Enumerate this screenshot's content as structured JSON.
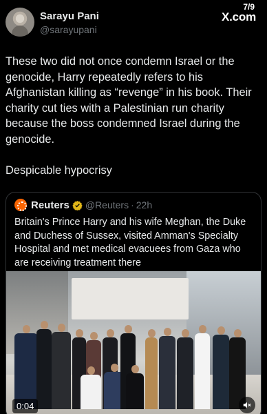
{
  "status": {
    "counter": "7/9",
    "brand": "X.com"
  },
  "author": {
    "name": "Sarayu Pani",
    "handle": "@sarayupani"
  },
  "tweet": {
    "paragraph1": "These two did not once condemn Israel or the genocide, Harry repeatedly refers to his Afghanistan killing as “revenge” in his book. Their charity cut ties with a Palestinian run charity because the boss condemned Israel during the genocide.",
    "paragraph2": "Despicable hypocrisy"
  },
  "quoted": {
    "name": "Reuters",
    "handle": "@Reuters",
    "separator": "·",
    "time": "22h",
    "text": "Britain's Prince Harry and his wife Meghan, the Duke and Duchess of Sussex, visited Amman's Specialty Hospital and met medical evacuees from Gaza who are receiving treatment there",
    "video": {
      "duration": "0:04"
    }
  },
  "icons": {
    "verified": "verified-badge-icon",
    "logo": "reuters-logo-icon",
    "mute": "speaker-muted-icon"
  },
  "colors": {
    "background": "#000000",
    "text": "#e7e9ea",
    "muted": "#71767b",
    "border": "#333639",
    "verified": "#e2b719",
    "reuters": "#fa6400"
  }
}
